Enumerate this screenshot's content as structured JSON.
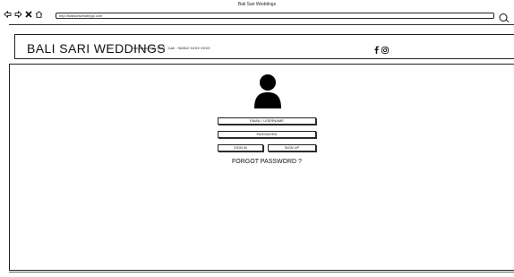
{
  "window": {
    "title": "Bali Sari Weddings"
  },
  "browser": {
    "url": "http://balisariweddings.com"
  },
  "header": {
    "brand": "BALI SARI WEDDINGS",
    "contact": "Denpasar, Bali, 0123  .  Call : +62812 XXXX XXXX",
    "social_icons": [
      "facebook-icon",
      "instagram-icon"
    ]
  },
  "login": {
    "email_placeholder": "EMAIL / USERNAME",
    "password_placeholder": "PASSWORD",
    "sign_in_label": "SIGN IN",
    "sign_up_label": "SIGN UP",
    "forgot_label": "FORGOT PASSWORD ?"
  },
  "icons": [
    "back-icon",
    "forward-icon",
    "close-icon",
    "home-icon",
    "search-icon",
    "user-avatar-icon"
  ]
}
